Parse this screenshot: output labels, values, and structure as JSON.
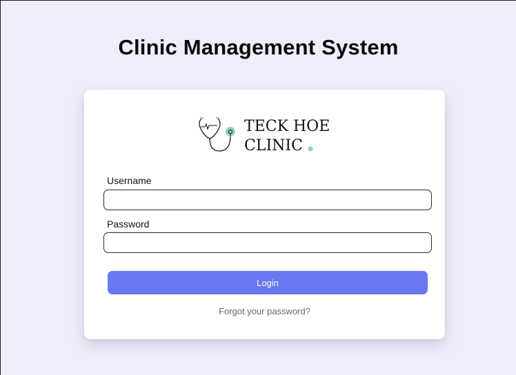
{
  "page": {
    "title": "Clinic Management System"
  },
  "logo": {
    "line1": "TECK HOE",
    "line2": "CLINIC",
    "accent_color": "#8dd7c4",
    "icon": "stethoscope-heartbeat-icon"
  },
  "form": {
    "username_label": "Username",
    "username_value": "",
    "password_label": "Password",
    "password_value": "",
    "login_label": "Login",
    "forgot_label": "Forgot your password?"
  },
  "colors": {
    "background": "#eeeefb",
    "card": "#ffffff",
    "primary_button": "#6878f0",
    "link_text": "#666666"
  }
}
